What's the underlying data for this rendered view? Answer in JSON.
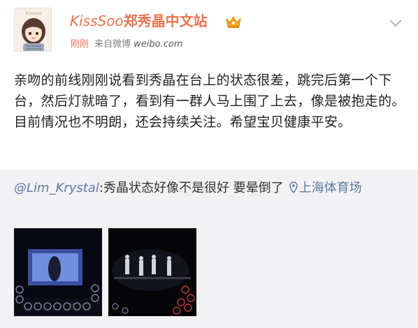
{
  "post": {
    "author": {
      "name_latin": "KissSoo",
      "name_cn": "郑秀晶中文站",
      "avatar_caption": "KissSoo"
    },
    "time": "刚刚",
    "source_prefix": "来自微博",
    "source_site": "weibo.com",
    "text": "亲吻的前线刚刚说看到秀晶在台上的状态很差，跳完后第一个下台，然后灯就暗了，看到有一群人马上围了上去，像是被抱走的。目前情况也不明朗，还会持续关注。希望宝贝健康平安。"
  },
  "repost": {
    "user": "@Lim_Krystal",
    "text": ":秀晶状态好像不是很好 要晕倒了",
    "location": "上海体育场",
    "images": [
      {
        "icon": "concert-photo-screen"
      },
      {
        "icon": "concert-photo-stage"
      }
    ]
  },
  "colors": {
    "accent": "#eb7350",
    "link": "#5d7ba3",
    "repost_bg": "#f2f2f5"
  }
}
